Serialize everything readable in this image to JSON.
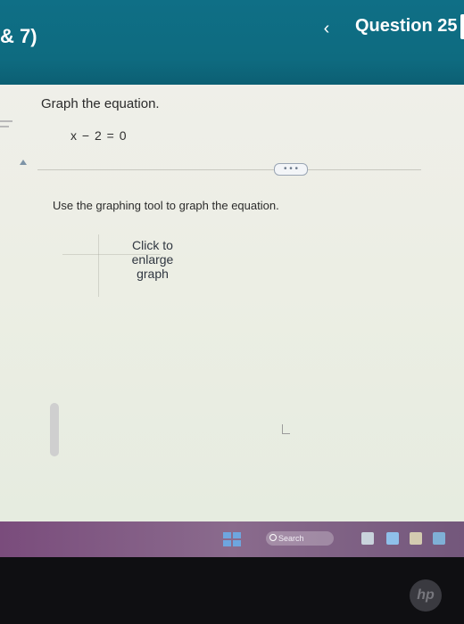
{
  "header": {
    "left_text": "& 7)",
    "back_icon": "chevron-left-icon",
    "question_title": "Question 25"
  },
  "question": {
    "prompt": "Graph the equation.",
    "equation": "x − 2 = 0",
    "instruction": "Use the graphing tool to graph the equation.",
    "enlarge_link": "Click to enlarge graph",
    "ellipsis": "• • •"
  },
  "taskbar": {
    "search_placeholder": "Search",
    "colors": {
      "taskbar": "#7a4c7c",
      "header": "#0f6f86"
    }
  },
  "bezel": {
    "logo": "hp"
  }
}
